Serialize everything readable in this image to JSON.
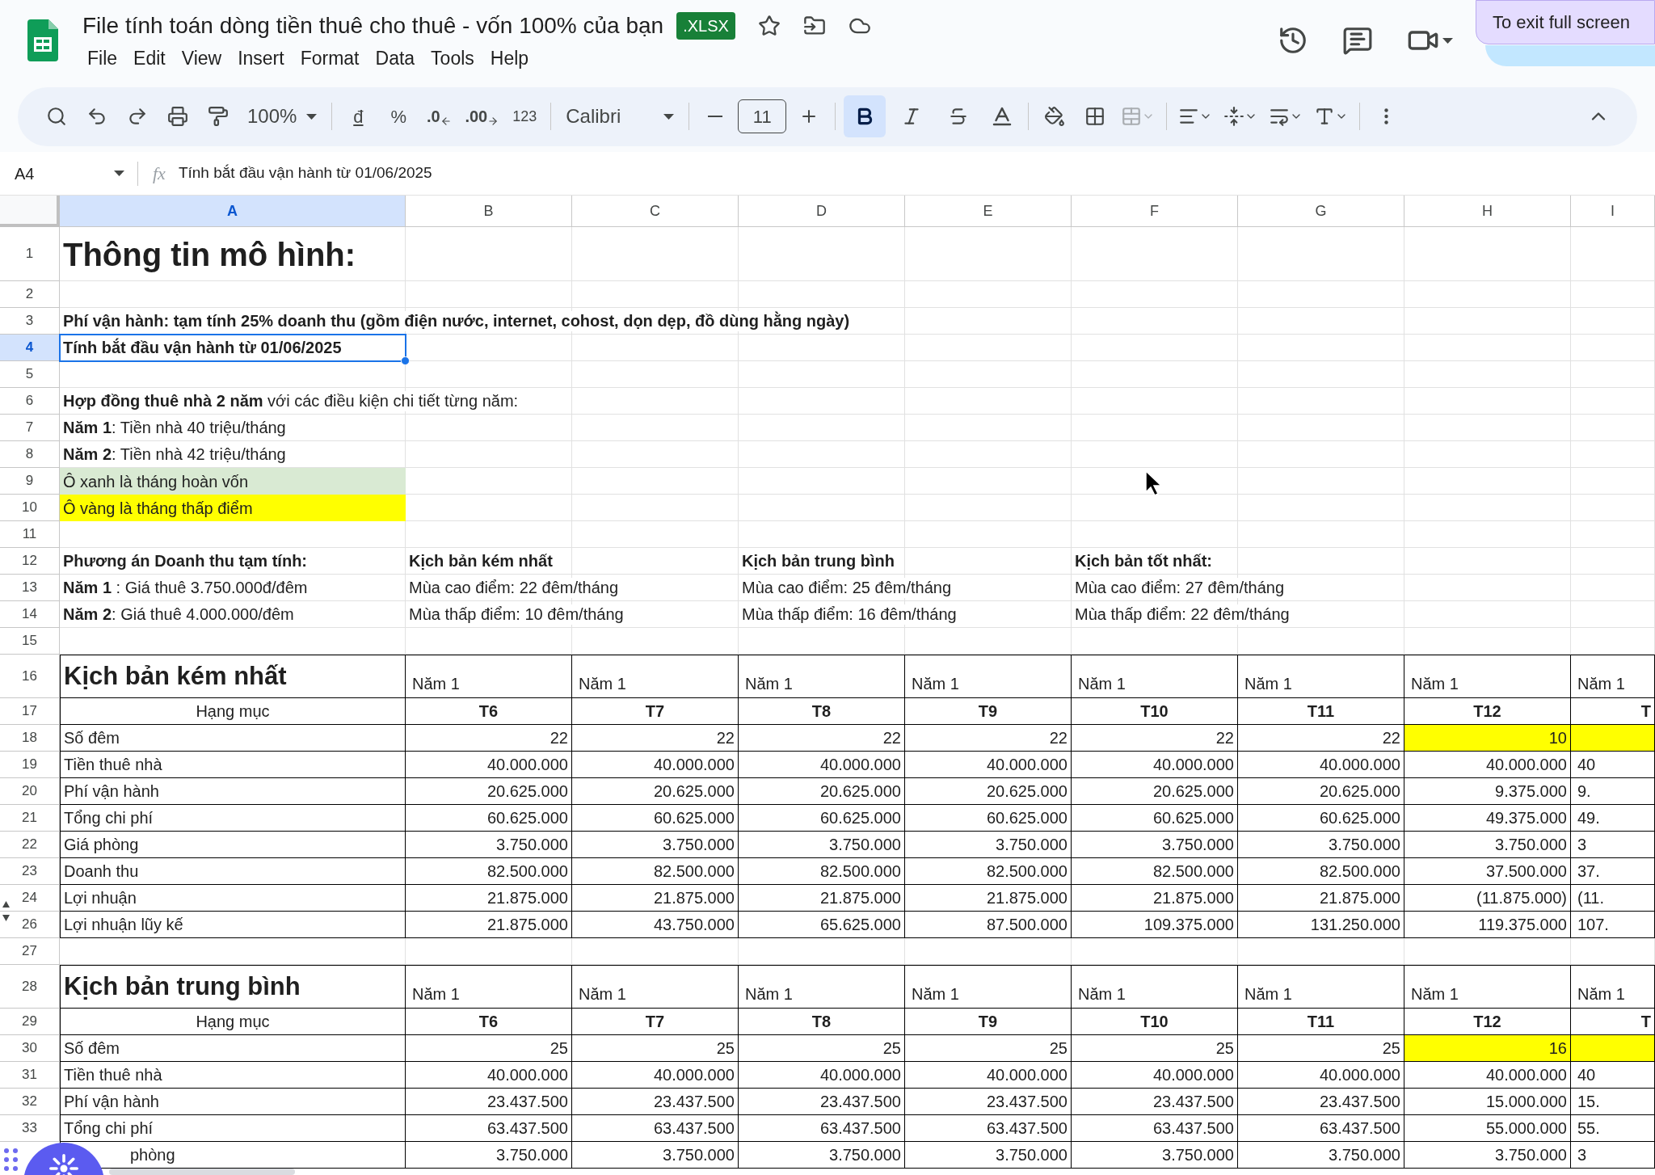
{
  "document": {
    "title": "File tính toán dòng tiền thuê cho thuê - vốn 100% của bạn",
    "badge": ".XLSX"
  },
  "menu": [
    "File",
    "Edit",
    "View",
    "Insert",
    "Format",
    "Data",
    "Tools",
    "Help"
  ],
  "fullscreen_hint": "To exit full screen",
  "toolbar": {
    "zoom": "100%",
    "currency": "đ",
    "percent": "%",
    "decrease_decimals": ".0",
    "increase_decimals": ".00",
    "number_format": "123",
    "font": "Calibri",
    "font_size": "11",
    "format_buttons": [
      {
        "kind": "bold",
        "selected": true
      },
      {
        "kind": "italic",
        "selected": false
      },
      {
        "kind": "strikethrough",
        "selected": false
      }
    ]
  },
  "formula_bar": {
    "name_box": "A4",
    "fx": "fx",
    "formula": "Tính bắt đầu vận hành từ 01/06/2025"
  },
  "columns": [
    {
      "label": "A",
      "selected": true
    },
    {
      "label": "B",
      "selected": false
    },
    {
      "label": "C",
      "selected": false
    },
    {
      "label": "D",
      "selected": false
    },
    {
      "label": "E",
      "selected": false
    },
    {
      "label": "F",
      "selected": false
    },
    {
      "label": "G",
      "selected": false
    },
    {
      "label": "H",
      "selected": false
    },
    {
      "label": "I",
      "selected": false
    }
  ],
  "rows": [
    {
      "n": "1",
      "kind": "title",
      "selected": false,
      "cells": [
        "Thông tin mô hình:"
      ]
    },
    {
      "n": "2",
      "kind": "blank",
      "selected": false,
      "cells": []
    },
    {
      "n": "3",
      "kind": "bold",
      "selected": false,
      "cells": [
        "Phí vận hành: tạm tính 25% doanh thu (gồm điện nước, internet, cohost, dọn dẹp, đồ dùng hằng ngày)"
      ]
    },
    {
      "n": "4",
      "kind": "bold",
      "selected": true,
      "cells": [
        "Tính bắt đầu vận hành từ 01/06/2025"
      ]
    },
    {
      "n": "5",
      "kind": "blank",
      "selected": false,
      "cells": []
    },
    {
      "n": "6",
      "kind": "note",
      "selected": false,
      "cells": [
        "**Hợp đồng thuê nhà 2 năm** với các điều kiện chi tiết từng năm:"
      ]
    },
    {
      "n": "7",
      "kind": "note",
      "selected": false,
      "cells": [
        "**Năm 1**: Tiền nhà 40 triệu/tháng"
      ]
    },
    {
      "n": "8",
      "kind": "note",
      "selected": false,
      "cells": [
        "**Năm 2**: Tiền nhà 42 triệu/tháng"
      ]
    },
    {
      "n": "9",
      "kind": "note",
      "selected": false,
      "cells": [
        {
          "text": "Ô xanh là tháng hoàn vốn",
          "color": "#d9ead3"
        }
      ]
    },
    {
      "n": "10",
      "kind": "note",
      "selected": false,
      "cells": [
        {
          "text": "Ô vàng là tháng thấp điểm",
          "color": "#ffff00"
        }
      ]
    },
    {
      "n": "11",
      "kind": "blank",
      "selected": false,
      "cells": []
    },
    {
      "n": "12",
      "kind": "bold",
      "selected": false,
      "cells": [
        "Phương án Doanh thu tạm tính:",
        "Kịch bản kém nhất",
        null,
        "Kịch bản trung bình",
        null,
        "Kịch bản tốt nhất:"
      ]
    },
    {
      "n": "13",
      "kind": "note",
      "selected": false,
      "cells": [
        "**Năm 1** : Giá thuê 3.750.000đ/đêm",
        "Mùa cao điểm: 22 đêm/tháng",
        null,
        "Mùa cao điểm: 25 đêm/tháng",
        null,
        "Mùa cao điểm: 27 đêm/tháng"
      ]
    },
    {
      "n": "14",
      "kind": "note",
      "selected": false,
      "cells": [
        "**Năm 2**: Giá thuê 4.000.000/đêm",
        "Mùa thấp điểm: 10 đêm/tháng",
        null,
        "Mùa thấp điểm: 16 đêm/tháng",
        null,
        "Mùa thấp điểm: 22 đêm/tháng"
      ]
    },
    {
      "n": "15",
      "kind": "blank",
      "selected": false,
      "cells": []
    },
    {
      "n": "16",
      "kind": "section",
      "selected": false,
      "cells": [
        "Kịch bản kém nhất",
        "Năm 1",
        "Năm 1",
        "Năm 1",
        "Năm 1",
        "Năm 1",
        "Năm 1",
        "Năm 1",
        "Năm 1"
      ]
    },
    {
      "n": "17",
      "kind": "header",
      "selected": false,
      "cells": [
        "Hạng mục",
        "T6",
        "T7",
        "T8",
        "T9",
        "T10",
        "T11",
        "T12",
        "T"
      ]
    },
    {
      "n": "18",
      "kind": "data",
      "selected": false,
      "cells": [
        "Số đêm",
        "22",
        "22",
        "22",
        "22",
        "22",
        "22",
        {
          "text": "10",
          "color": "#ffff00"
        },
        {
          "color": "#ffff00"
        }
      ]
    },
    {
      "n": "19",
      "kind": "data",
      "selected": false,
      "cells": [
        "Tiền thuê nhà",
        "40.000.000",
        "40.000.000",
        "40.000.000",
        "40.000.000",
        "40.000.000",
        "40.000.000",
        "40.000.000",
        "40"
      ]
    },
    {
      "n": "20",
      "kind": "data",
      "selected": false,
      "cells": [
        "Phí vận hành",
        "20.625.000",
        "20.625.000",
        "20.625.000",
        "20.625.000",
        "20.625.000",
        "20.625.000",
        "9.375.000",
        "9."
      ]
    },
    {
      "n": "21",
      "kind": "data",
      "selected": false,
      "cells": [
        "Tổng chi phí",
        "60.625.000",
        "60.625.000",
        "60.625.000",
        "60.625.000",
        "60.625.000",
        "60.625.000",
        "49.375.000",
        "49."
      ]
    },
    {
      "n": "22",
      "kind": "data",
      "selected": false,
      "cells": [
        "Giá phòng",
        "3.750.000",
        "3.750.000",
        "3.750.000",
        "3.750.000",
        "3.750.000",
        "3.750.000",
        "3.750.000",
        "3"
      ]
    },
    {
      "n": "23",
      "kind": "data",
      "selected": false,
      "cells": [
        "Doanh thu",
        "82.500.000",
        "82.500.000",
        "82.500.000",
        "82.500.000",
        "82.500.000",
        "82.500.000",
        "37.500.000",
        "37."
      ]
    },
    {
      "n": "24",
      "kind": "data",
      "selected": false,
      "hidden_below": true,
      "cells": [
        "Lợi nhuận",
        "21.875.000",
        "21.875.000",
        "21.875.000",
        "21.875.000",
        "21.875.000",
        "21.875.000",
        "(11.875.000)",
        "(11."
      ]
    },
    {
      "n": "26",
      "kind": "data",
      "selected": false,
      "hidden_above": true,
      "cells": [
        "Lợi nhuận lũy kế",
        "21.875.000",
        "43.750.000",
        "65.625.000",
        "87.500.000",
        "109.375.000",
        "131.250.000",
        "119.375.000",
        "107."
      ]
    },
    {
      "n": "27",
      "kind": "blank",
      "selected": false,
      "cells": []
    },
    {
      "n": "28",
      "kind": "section",
      "selected": false,
      "cells": [
        "Kịch bản trung bình",
        "Năm 1",
        "Năm 1",
        "Năm 1",
        "Năm 1",
        "Năm 1",
        "Năm 1",
        "Năm 1",
        "Năm 1"
      ]
    },
    {
      "n": "29",
      "kind": "header",
      "selected": false,
      "cells": [
        "Hạng mục",
        "T6",
        "T7",
        "T8",
        "T9",
        "T10",
        "T11",
        "T12",
        "T"
      ]
    },
    {
      "n": "30",
      "kind": "data",
      "selected": false,
      "cells": [
        "Số đêm",
        "25",
        "25",
        "25",
        "25",
        "25",
        "25",
        {
          "text": "16",
          "color": "#ffff00"
        },
        {
          "color": "#ffff00"
        }
      ]
    },
    {
      "n": "31",
      "kind": "data",
      "selected": false,
      "cells": [
        "Tiền thuê nhà",
        "40.000.000",
        "40.000.000",
        "40.000.000",
        "40.000.000",
        "40.000.000",
        "40.000.000",
        "40.000.000",
        "40"
      ]
    },
    {
      "n": "32",
      "kind": "data",
      "selected": false,
      "cells": [
        "Phí vận hành",
        "23.437.500",
        "23.437.500",
        "23.437.500",
        "23.437.500",
        "23.437.500",
        "23.437.500",
        "15.000.000",
        "15."
      ]
    },
    {
      "n": "33",
      "kind": "data",
      "selected": false,
      "cells": [
        "Tổng chi phí",
        "63.437.500",
        "63.437.500",
        "63.437.500",
        "63.437.500",
        "63.437.500",
        "63.437.500",
        "55.000.000",
        "55."
      ]
    },
    {
      "kind": "data",
      "selected": false,
      "cells": [
        "phòng",
        "3.750.000",
        "3.750.000",
        "3.750.000",
        "3.750.000",
        "3.750.000",
        "3.750.000",
        "3.750.000",
        "3"
      ]
    }
  ]
}
